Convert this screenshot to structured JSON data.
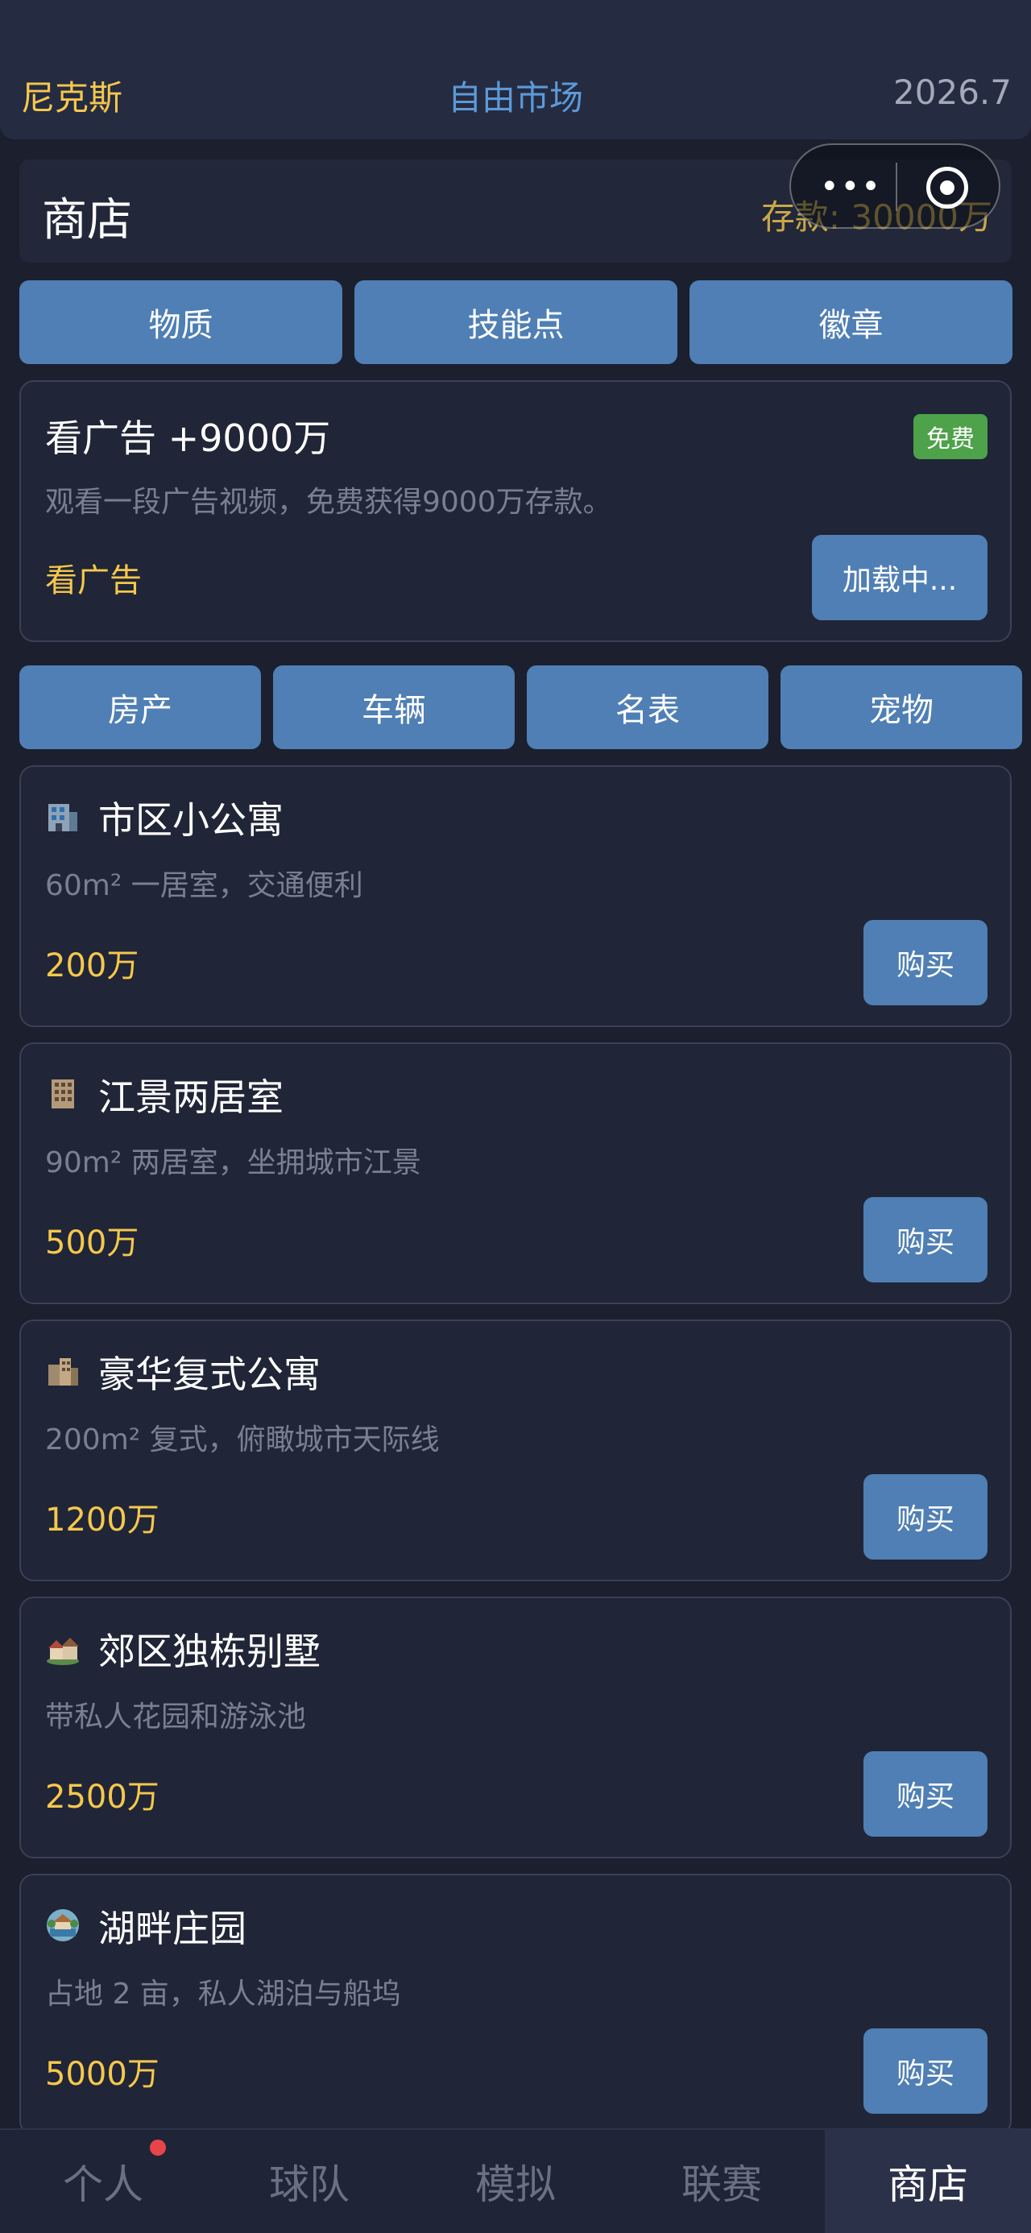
{
  "header": {
    "team": "尼克斯",
    "title": "自由市场",
    "season": "2026.7"
  },
  "shop": {
    "title": "商店",
    "deposit": "存款: 30000万"
  },
  "capsule": {
    "more": "•••"
  },
  "top_tabs": [
    "物质",
    "技能点",
    "徽章"
  ],
  "ad": {
    "title": "看广告 +9000万",
    "badge": "免费",
    "desc": "观看一段广告视频，免费获得9000万存款。",
    "link": "看广告",
    "button": "加载中..."
  },
  "category_tabs": [
    "房产",
    "车辆",
    "名表",
    "宠物"
  ],
  "items": [
    {
      "name": "市区小公寓",
      "desc": "60m² 一居室，交通便利",
      "price": "200万",
      "buy": "购买",
      "icon": "apartment-icon"
    },
    {
      "name": "江景两居室",
      "desc": "90m² 两居室，坐拥城市江景",
      "price": "500万",
      "buy": "购买",
      "icon": "office-building-icon"
    },
    {
      "name": "豪华复式公寓",
      "desc": "200m² 复式，俯瞰城市天际线",
      "price": "1200万",
      "buy": "购买",
      "icon": "city-icon"
    },
    {
      "name": "郊区独栋别墅",
      "desc": "带私人花园和游泳池",
      "price": "2500万",
      "buy": "购买",
      "icon": "houses-icon"
    },
    {
      "name": "湖畔庄园",
      "desc": "占地 2 亩，私人湖泊与船坞",
      "price": "5000万",
      "buy": "购买",
      "icon": "lake-estate-icon"
    }
  ],
  "nav": [
    "个人",
    "球队",
    "模拟",
    "联赛",
    "商店"
  ],
  "colors": {
    "accent_blue": "#4f7fb4",
    "gold": "#f5c84c",
    "badge_green": "#4ea24a",
    "notify_red": "#e8454a"
  }
}
